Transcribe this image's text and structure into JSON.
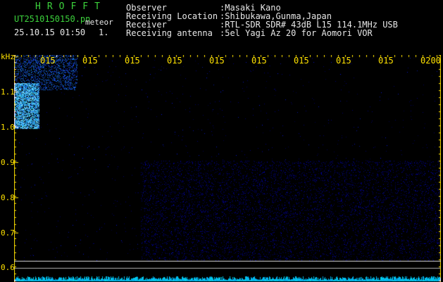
{
  "header": {
    "brand": "HROFFT",
    "filename": "UT2510150150.pn",
    "event_type": "meteor",
    "datetime": "25.10.15 01:50",
    "index": "1.",
    "info": [
      {
        "label": "Observer",
        "value": ":Masaki Kano"
      },
      {
        "label": "Receiving Location",
        "value": ":Shibukawa,Gunma,Japan"
      },
      {
        "label": "Receiver",
        "value": ":RTL-SDR SDR# 43dB L15 114.1MHz USB"
      },
      {
        "label": "Receiving antenna",
        "value": ":5el Yagi Az 20 for Aomori VOR"
      }
    ]
  },
  "time_axis": {
    "labels": [
      "015",
      "015",
      "015",
      "015",
      "015",
      "015",
      "015",
      "015",
      "015",
      "0200"
    ]
  },
  "freq_axis": {
    "unit": "kHz",
    "labels": [
      "1.1",
      "1.0",
      "0.9",
      "0.8",
      "0.7",
      "0.6"
    ]
  },
  "colors": {
    "background": "#000000",
    "header_green": "#3cd23c",
    "text_white": "#e8e8e8",
    "axis_yellow": "#ffe200",
    "signal_blue": "#2b52ff",
    "noise_cyan": "#00c8ff"
  }
}
